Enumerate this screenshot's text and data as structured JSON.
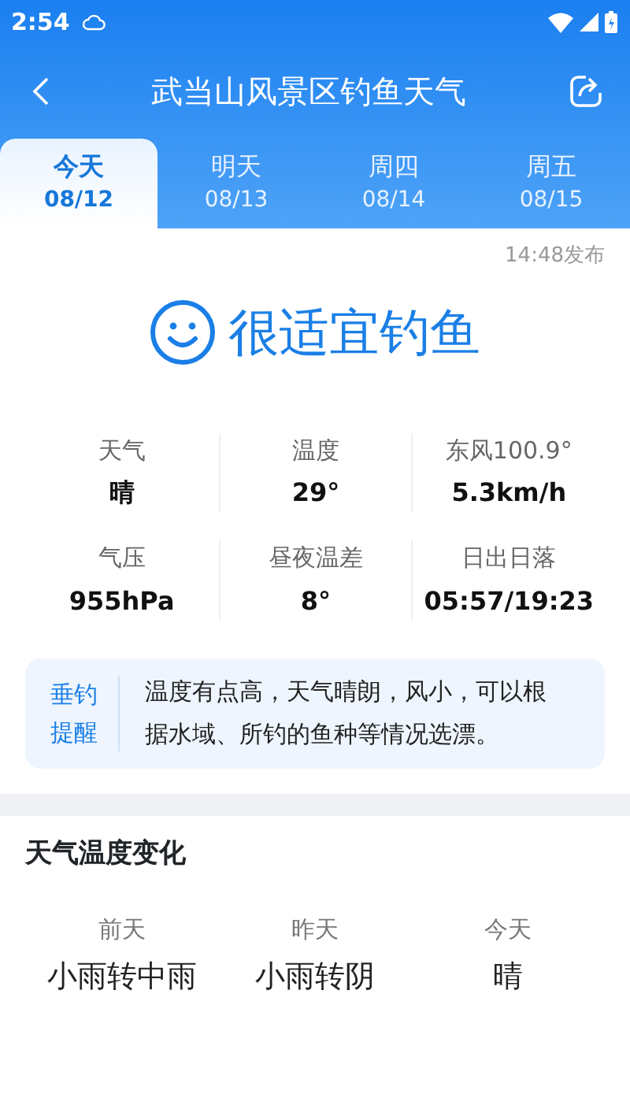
{
  "status_bar": {
    "time": "2:54"
  },
  "header": {
    "title": "武当山风景区钓鱼天气"
  },
  "tabs": [
    {
      "day": "今天",
      "date": "08/12",
      "selected": true
    },
    {
      "day": "明天",
      "date": "08/13",
      "selected": false
    },
    {
      "day": "周四",
      "date": "08/14",
      "selected": false
    },
    {
      "day": "周五",
      "date": "08/15",
      "selected": false
    }
  ],
  "published": "14:48发布",
  "verdict": "很适宜钓鱼",
  "stats": [
    {
      "label": "天气",
      "value": "晴"
    },
    {
      "label": "温度",
      "value": "29°"
    },
    {
      "label": "东风100.9°",
      "value": "5.3km/h"
    },
    {
      "label": "气压",
      "value": "955hPa"
    },
    {
      "label": "昼夜温差",
      "value": "8°"
    },
    {
      "label": "日出日落",
      "value": "05:57/19:23"
    }
  ],
  "tip": {
    "label": "垂钓提醒",
    "text": "温度有点高，天气晴朗，风小，可以根据水域、所钓的鱼种等情况选漂。"
  },
  "trend": {
    "title": "天气温度变化",
    "days": [
      {
        "day": "前天",
        "weather": "小雨转中雨"
      },
      {
        "day": "昨天",
        "weather": "小雨转阴"
      },
      {
        "day": "今天",
        "weather": "晴"
      }
    ]
  }
}
